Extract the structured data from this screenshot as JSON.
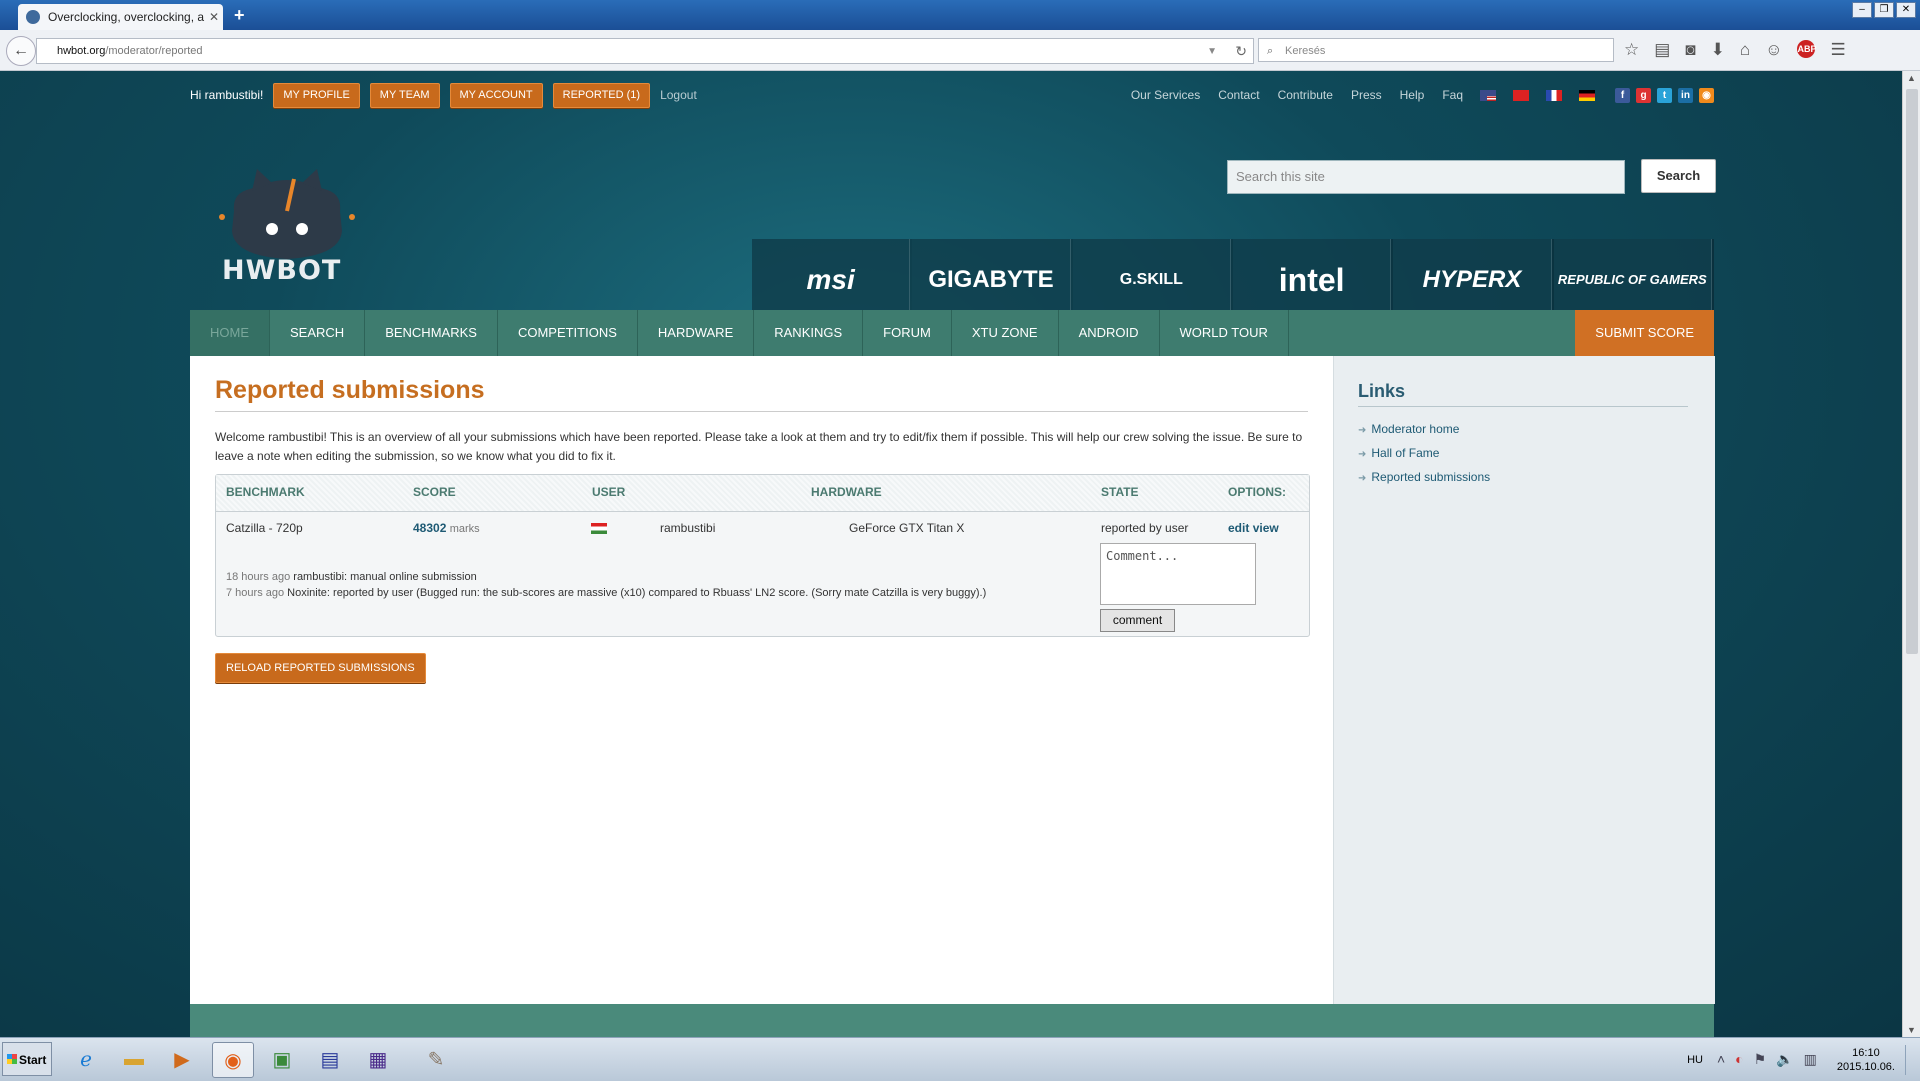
{
  "browser": {
    "tab_title": "Overclocking, overclocking, a...",
    "new_tab": "+",
    "url_host": "hwbot.org",
    "url_path": "/moderator/reported",
    "search_placeholder": "Keresés"
  },
  "userbar": {
    "greeting": "Hi rambustibi!",
    "buttons": [
      "MY PROFILE",
      "MY TEAM",
      "MY ACCOUNT",
      "REPORTED (1)"
    ],
    "logout": "Logout",
    "links": [
      "Our Services",
      "Contact",
      "Contribute",
      "Press",
      "Help",
      "Faq"
    ]
  },
  "logo": {
    "text": "HWBOT"
  },
  "site_search": {
    "placeholder": "Search this site",
    "button": "Search"
  },
  "sponsors": [
    "msi",
    "GIGABYTE",
    "G.SKILL",
    "intel",
    "HYPERX",
    "REPUBLIC OF GAMERS"
  ],
  "nav": {
    "items": [
      "HOME",
      "SEARCH",
      "BENCHMARKS",
      "COMPETITIONS",
      "HARDWARE",
      "RANKINGS",
      "FORUM",
      "XTU ZONE",
      "ANDROID",
      "WORLD TOUR"
    ],
    "submit": "SUBMIT SCORE"
  },
  "main": {
    "title": "Reported submissions",
    "intro": "Welcome rambustibi! This is an overview of all your submissions which have been reported. Please take a look at them and try to edit/fix them if possible. This will help our crew solving the issue. Be sure to leave a note when editing the submission, so we know what you did to fix it.",
    "columns": [
      "BENCHMARK",
      "SCORE",
      "USER",
      "HARDWARE",
      "STATE",
      "OPTIONS:"
    ],
    "row": {
      "benchmark": "Catzilla - 720p",
      "score": "48302",
      "score_unit": "marks",
      "user": "rambustibi",
      "hardware": "GeForce GTX Titan X",
      "state": "reported by user",
      "edit": "edit",
      "view": "view"
    },
    "log": [
      {
        "ago": "18 hours ago",
        "text": "rambustibi: manual online submission"
      },
      {
        "ago": "7 hours ago",
        "text": "Noxinite: reported by user (Bugged run: the sub-scores are massive (x10) compared to Rbuass' LN2 score. (Sorry mate Catzilla is very buggy).)"
      }
    ],
    "comment_placeholder": "Comment...",
    "comment_button": "comment",
    "reload_button": "RELOAD REPORTED SUBMISSIONS"
  },
  "sidebar": {
    "title": "Links",
    "links": [
      "Moderator home",
      "Hall of Fame",
      "Reported submissions"
    ]
  },
  "taskbar": {
    "start": "Start",
    "lang": "HU",
    "time": "16:10",
    "date": "2015.10.06."
  }
}
